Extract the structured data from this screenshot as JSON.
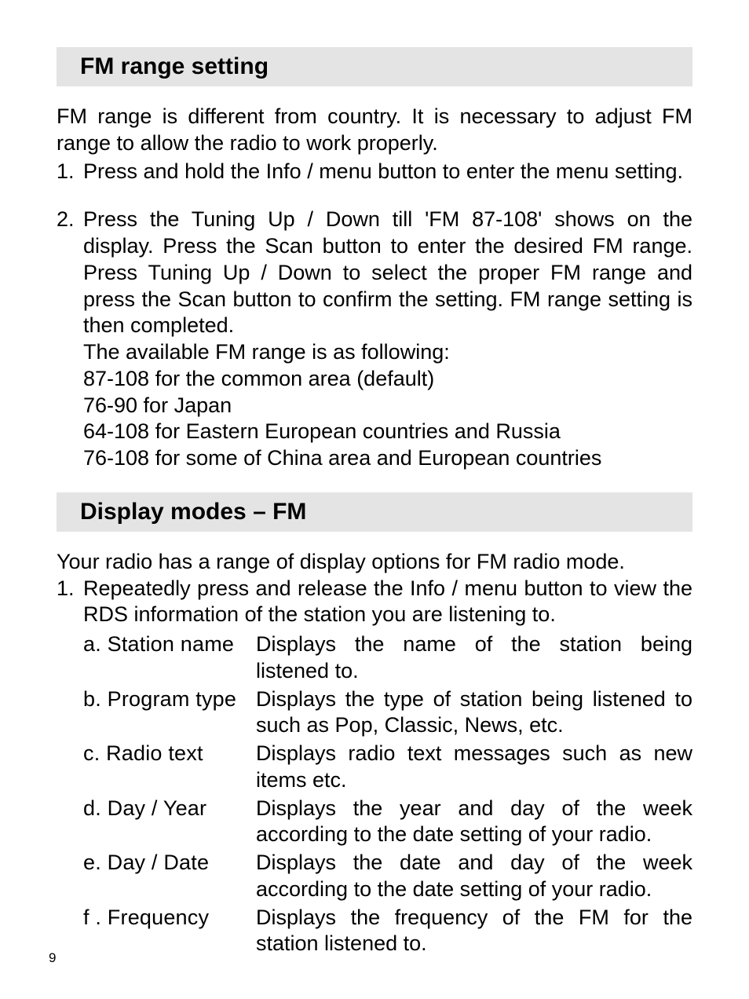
{
  "section1": {
    "heading": "FM range setting",
    "intro": "FM range is different from country. It is necessary to adjust FM range to allow the radio to work properly.",
    "step1_marker": "1.",
    "step1": "Press and hold the Info / menu button to enter the menu setting.",
    "step2_marker": "2.",
    "step2": "Press the Tuning Up / Down till 'FM 87-108' shows on the display. Press the Scan button to enter the desired FM range. Press Tuning Up / Down to select the proper FM range and press the Scan button to confirm the setting. FM range setting is then completed.",
    "range_intro": "The available FM range is as following:",
    "range_a": "87-108 for the common area (default)",
    "range_b": "76-90 for Japan",
    "range_c": "64-108 for Eastern European countries and Russia",
    "range_d": "76-108 for some of China area and European countries"
  },
  "section2": {
    "heading": "Display modes – FM",
    "intro": "Your radio has a range of display options for FM radio mode.",
    "step1_marker": "1.",
    "step1": "Repeatedly press and release the Info / menu button to view the RDS information of the station you are listening to.",
    "items": [
      {
        "label": "a. Station name",
        "desc": "Displays the name of the station being listened to."
      },
      {
        "label": "b. Program type",
        "desc": "Displays the type of station being listened to such as Pop, Classic, News, etc."
      },
      {
        "label": "c. Radio text",
        "desc": "Displays radio text messages such as new items etc."
      },
      {
        "label": "d. Day / Year",
        "desc": "Displays the year and day of the week according to the date setting of your radio."
      },
      {
        "label": "e. Day / Date",
        "desc": "Displays the date and day of the week according to the date setting of your radio."
      },
      {
        "label": "f . Frequency",
        "desc": "Displays the frequency of the FM for the station listened to."
      }
    ]
  },
  "page_number": "9"
}
